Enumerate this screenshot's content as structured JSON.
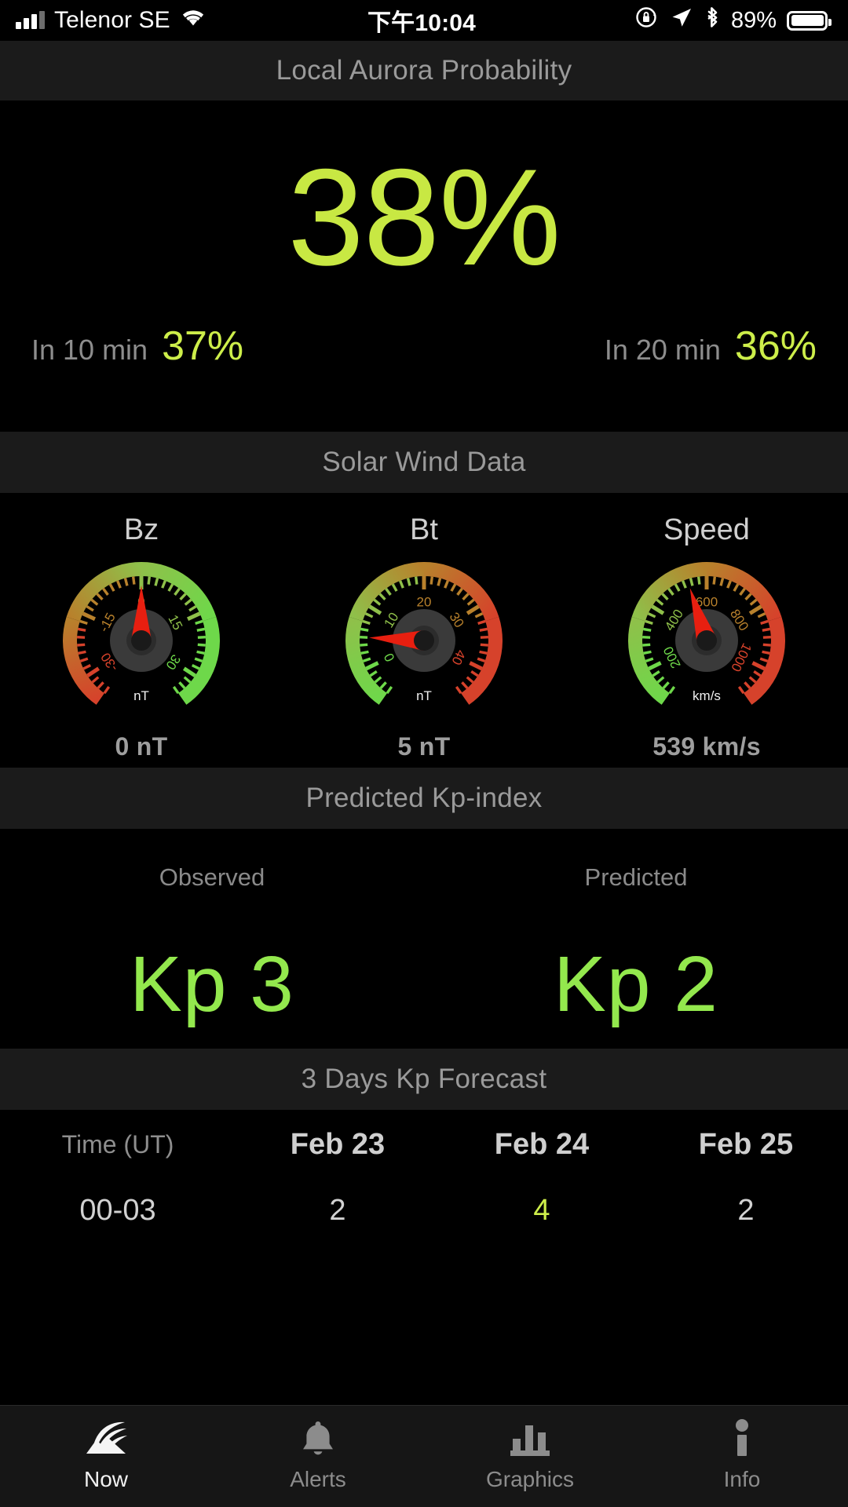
{
  "status_bar": {
    "carrier": "Telenor SE",
    "time": "下午10:04",
    "battery_percent": "89%",
    "icons": [
      "signal-bars-icon",
      "wifi-icon",
      "rotation-lock-icon",
      "location-arrow-icon",
      "bluetooth-icon",
      "battery-icon"
    ]
  },
  "sections": {
    "probability_header": "Local Aurora Probability",
    "solar_wind_header": "Solar Wind Data",
    "kp_header": "Predicted Kp-index",
    "forecast_header": "3 Days Kp Forecast"
  },
  "probability": {
    "current": "38%",
    "in10_label": "In 10 min",
    "in10_value": "37%",
    "in20_label": "In 20 min",
    "in20_value": "36%",
    "accent_color": "#c8e843"
  },
  "solar_wind": {
    "gauges": [
      {
        "title": "Bz",
        "unit": "nT",
        "value_text": "0 nT",
        "value": 0,
        "min": -35,
        "max": 35,
        "ticks": [
          -30,
          -15,
          0,
          15,
          30
        ],
        "tick_labels": [
          "-30",
          "-15",
          "0",
          "15",
          "30"
        ],
        "arc_colors": [
          "#d6422b",
          "#b8812c",
          "#8fc04a",
          "#6ed84a"
        ]
      },
      {
        "title": "Bt",
        "unit": "nT",
        "value_text": "5 nT",
        "value": 5,
        "min": -5,
        "max": 45,
        "ticks": [
          0,
          10,
          20,
          30,
          40
        ],
        "tick_labels": [
          "0",
          "10",
          "20",
          "30",
          "40"
        ],
        "arc_colors": [
          "#6ed84a",
          "#8fc04a",
          "#b8812c",
          "#d6422b"
        ]
      },
      {
        "title": "Speed",
        "unit": "km/s",
        "value_text": "539 km/s",
        "value": 539,
        "min": 100,
        "max": 1100,
        "ticks": [
          200,
          400,
          600,
          800,
          1000
        ],
        "tick_labels": [
          "200",
          "400",
          "600",
          "800",
          "1000"
        ],
        "arc_colors": [
          "#6ed84a",
          "#8fc04a",
          "#b8812c",
          "#d6422b"
        ]
      }
    ]
  },
  "kp": {
    "observed_label": "Observed",
    "observed_value": "Kp 3",
    "predicted_label": "Predicted",
    "predicted_value": "Kp 2",
    "color": "#93e84d"
  },
  "forecast": {
    "time_header": "Time (UT)",
    "days": [
      "Feb 23",
      "Feb 24",
      "Feb 25"
    ],
    "rows": [
      {
        "time": "00-03",
        "values": [
          "2",
          "4",
          "2"
        ],
        "colors": [
          "#d2d2d2",
          "#cdee4a",
          "#d2d2d2"
        ]
      }
    ]
  },
  "tabs": [
    {
      "label": "Now",
      "icon": "aurora-icon",
      "active": true
    },
    {
      "label": "Alerts",
      "icon": "bell-icon",
      "active": false
    },
    {
      "label": "Graphics",
      "icon": "bar-chart-icon",
      "active": false
    },
    {
      "label": "Info",
      "icon": "info-icon",
      "active": false
    }
  ]
}
